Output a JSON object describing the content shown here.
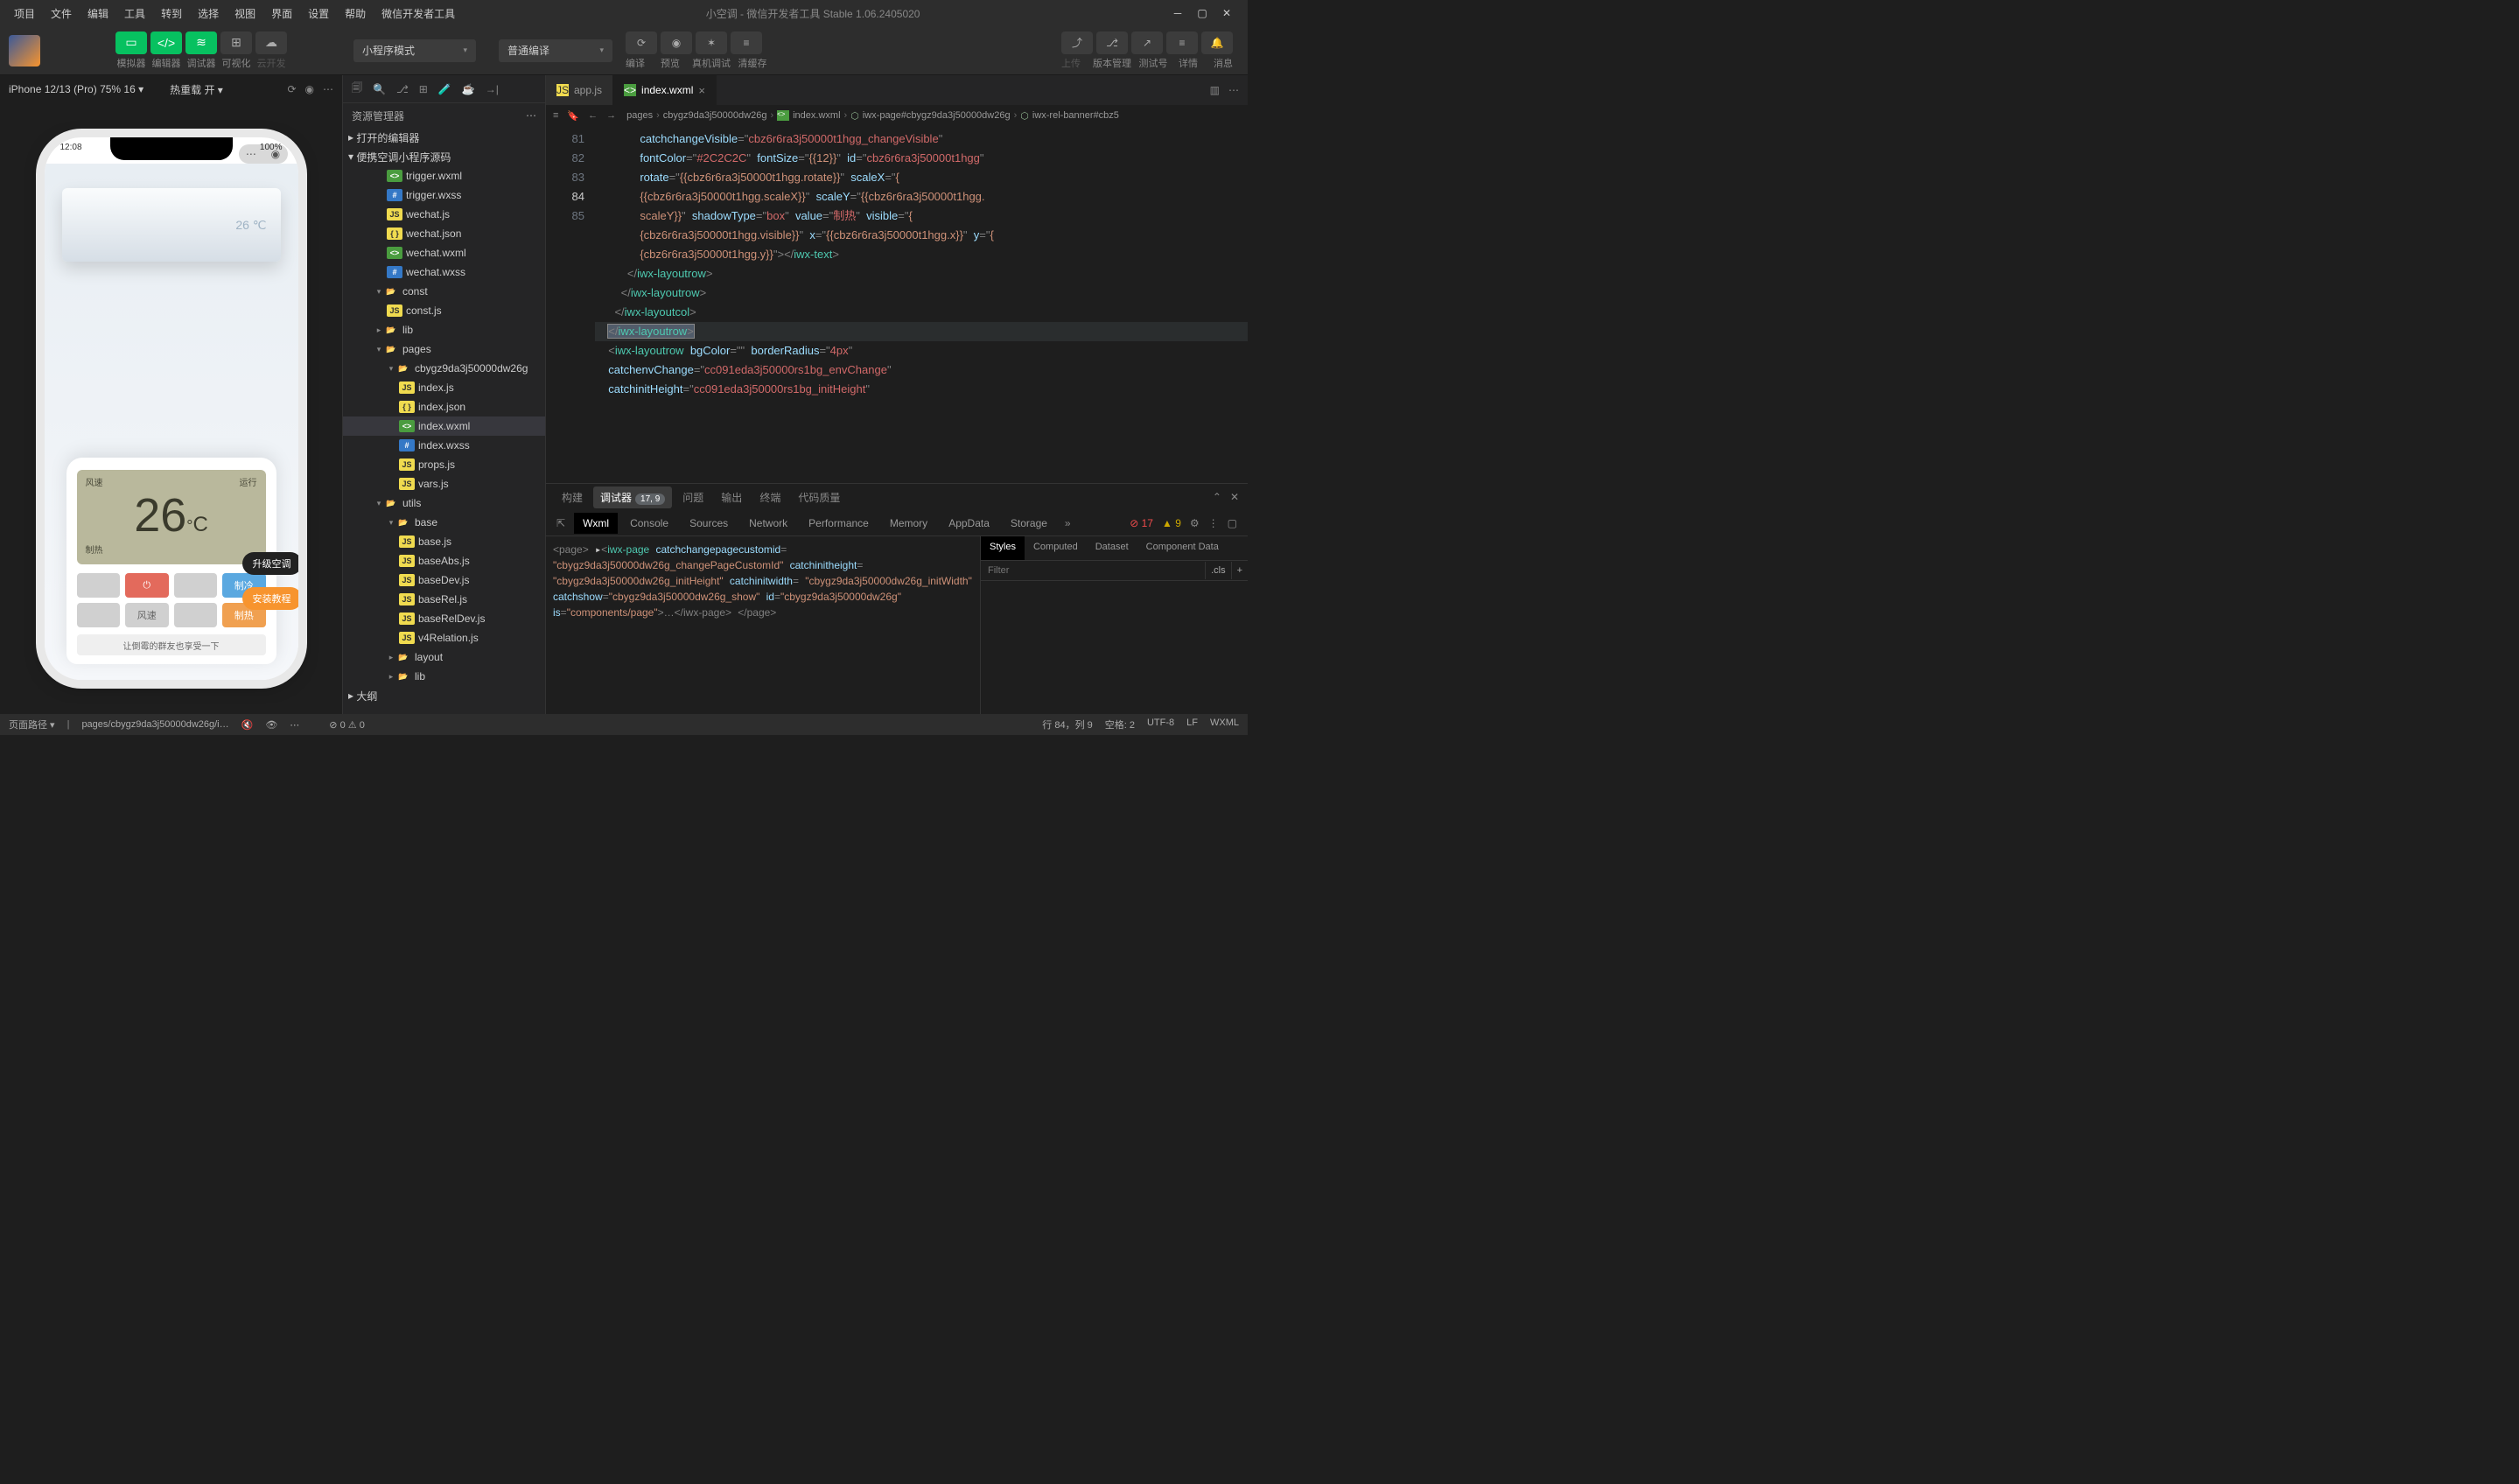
{
  "menubar": [
    "项目",
    "文件",
    "编辑",
    "工具",
    "转到",
    "选择",
    "视图",
    "界面",
    "设置",
    "帮助",
    "微信开发者工具"
  ],
  "title": "小空调 - 微信开发者工具 Stable 1.06.2405020",
  "toolbar": {
    "labels": [
      "模拟器",
      "编辑器",
      "调试器",
      "可视化",
      "云开发"
    ],
    "mode_dropdown": "小程序模式",
    "compile_dropdown": "普通编译",
    "compile": "编译",
    "preview": "预览",
    "real_debug": "真机调试",
    "clear_cache": "清缓存",
    "upload": "上传",
    "version_mgmt": "版本管理",
    "test_id": "测试号",
    "detail": "详情",
    "message": "消息"
  },
  "sim": {
    "device": "iPhone 12/13 (Pro) 75% 16",
    "hot_reload": "热重载 开",
    "time": "12:08",
    "battery": "100%",
    "ac_temp": "26 ℃",
    "lcd_top_left": "风速",
    "lcd_top_right": "运行",
    "lcd_temp": "26",
    "lcd_mode": "制热",
    "btn_cool": "制冷",
    "btn_wind": "风速",
    "btn_heat": "制热",
    "share": "让倒霉的群友也享受一下",
    "pill_upgrade": "升级空调",
    "pill_install": "安装教程"
  },
  "explorer": {
    "title": "资源管理器",
    "sections": {
      "open_editors": "打开的编辑器",
      "project": "便携空调小程序源码",
      "outline": "大纲"
    },
    "files": [
      {
        "name": "trigger.wxml",
        "type": "wxml",
        "indent": 3
      },
      {
        "name": "trigger.wxss",
        "type": "wxss",
        "indent": 3
      },
      {
        "name": "wechat.js",
        "type": "js",
        "indent": 3
      },
      {
        "name": "wechat.json",
        "type": "json",
        "indent": 3
      },
      {
        "name": "wechat.wxml",
        "type": "wxml",
        "indent": 3
      },
      {
        "name": "wechat.wxss",
        "type": "wxss",
        "indent": 3
      },
      {
        "name": "const",
        "type": "folder",
        "indent": 2,
        "exp": true
      },
      {
        "name": "const.js",
        "type": "js",
        "indent": 3
      },
      {
        "name": "lib",
        "type": "folder-g",
        "indent": 2,
        "exp": false
      },
      {
        "name": "pages",
        "type": "folder",
        "indent": 2,
        "exp": true
      },
      {
        "name": "cbygz9da3j50000dw26g",
        "type": "folder",
        "indent": 3,
        "exp": true
      },
      {
        "name": "index.js",
        "type": "js",
        "indent": 4
      },
      {
        "name": "index.json",
        "type": "json",
        "indent": 4
      },
      {
        "name": "index.wxml",
        "type": "wxml",
        "indent": 4,
        "active": true
      },
      {
        "name": "index.wxss",
        "type": "wxss",
        "indent": 4
      },
      {
        "name": "props.js",
        "type": "js",
        "indent": 4
      },
      {
        "name": "vars.js",
        "type": "js",
        "indent": 4
      },
      {
        "name": "utils",
        "type": "folder-g",
        "indent": 2,
        "exp": true
      },
      {
        "name": "base",
        "type": "folder",
        "indent": 3,
        "exp": true
      },
      {
        "name": "base.js",
        "type": "js",
        "indent": 4
      },
      {
        "name": "baseAbs.js",
        "type": "js",
        "indent": 4
      },
      {
        "name": "baseDev.js",
        "type": "js",
        "indent": 4
      },
      {
        "name": "baseRel.js",
        "type": "js",
        "indent": 4
      },
      {
        "name": "baseRelDev.js",
        "type": "js",
        "indent": 4
      },
      {
        "name": "v4Relation.js",
        "type": "js",
        "indent": 4
      },
      {
        "name": "layout",
        "type": "folder",
        "indent": 3,
        "exp": false
      },
      {
        "name": "lib",
        "type": "folder-g",
        "indent": 3,
        "exp": false
      }
    ]
  },
  "tabs": [
    {
      "name": "app.js",
      "icon": "js",
      "active": false
    },
    {
      "name": "index.wxml",
      "icon": "wxml",
      "active": true
    }
  ],
  "breadcrumb": [
    "pages",
    "cbygz9da3j50000dw26g",
    "index.wxml",
    "iwx-page#cbygz9da3j50000dw26g",
    "iwx-rel-banner#cbz5"
  ],
  "code": {
    "line_numbers": [
      "",
      "",
      "",
      "",
      "",
      "",
      "",
      "81",
      "82",
      "83",
      "84",
      "85",
      "",
      "",
      ""
    ],
    "current_line": 10,
    "frag": {
      "attr_catchchange": "catchchangeVisible",
      "val_catchchange": "cbz6r6ra3j50000t1hgg_changeVisible",
      "attr_fontcolor": "fontColor",
      "val_fontcolor": "#2C2C2C",
      "attr_fontsize": "fontSize",
      "val_fontsize": "{{12}}",
      "attr_id": "id",
      "val_id": "cbz6r6ra3j50000t1hgg",
      "attr_rotate": "rotate",
      "val_rotate_a": "{{cbz6r6ra3j50000t1hgg.rotate}}",
      "attr_scalex": "scaleX",
      "val_scalex": "{{cbz6r6ra3j50000t1hgg.scaleX}}",
      "attr_scaley": "scaleY",
      "val_scaley_a": "{{cbz6r6ra3j50000t1hgg.",
      "val_scaley_b": "scaleY}}",
      "attr_shadow": "shadowType",
      "val_shadow": "box",
      "attr_value": "value",
      "val_value": "制热",
      "attr_visible": "visible",
      "val_visible_a": "{",
      "val_visible_b": "{cbz6r6ra3j50000t1hgg.visible}}",
      "attr_x": "x",
      "val_x": "{{cbz6r6ra3j50000t1hgg.x}}",
      "attr_y": "y",
      "val_y_a": "{",
      "val_y_b": "{cbz6r6ra3j50000t1hgg.y}}",
      "close_text": "iwx-text",
      "close_layoutrow": "iwx-layoutrow",
      "close_layoutcol": "iwx-layoutcol",
      "open_layoutrow": "iwx-layoutrow",
      "attr_bgcolor": "bgColor",
      "attr_border": "borderRadius",
      "val_border": "4px",
      "attr_catchenv": "catchenvChange",
      "val_catchenv": "cc091eda3j50000rs1bg_envChange",
      "attr_catchinit": "catchinitHeight",
      "val_catchinit": "cc091eda3j50000rs1bg_initHeight"
    }
  },
  "bpanel": {
    "tabs": [
      "构建",
      "调试器",
      "问题",
      "输出",
      "终端",
      "代码质量"
    ],
    "badge": "17, 9",
    "active_idx": 1
  },
  "devtools": {
    "tabs": [
      "Wxml",
      "Console",
      "Sources",
      "Network",
      "Performance",
      "Memory",
      "AppData",
      "Storage"
    ],
    "errors": "17",
    "warnings": "9",
    "dom_page_open": "<page>",
    "dom_iwxpage": "iwx-page",
    "dom_attr1": "catchchangepagecustomid",
    "dom_val1": "cbygz9da3j50000dw26g_changePageCustomId",
    "dom_attr2": "catchinitheight",
    "dom_val2": "cbygz9da3j50000dw26g_initHeight",
    "dom_attr3": "catchinitwidth",
    "dom_val3": "cbygz9da3j50000dw26g_initWidth",
    "dom_attr4": "catchshow",
    "dom_val4": "cbygz9da3j50000dw26g_show",
    "dom_attr5": "id",
    "dom_val5": "cbygz9da3j50000dw26g",
    "dom_attr6": "is",
    "dom_val6": "components/page",
    "dom_close_iwx": "</iwx-page>",
    "dom_page_close": "</page>",
    "styles_tabs": [
      "Styles",
      "Computed",
      "Dataset",
      "Component Data"
    ],
    "filter_ph": "Filter",
    "cls": ".cls"
  },
  "status": {
    "page_path_label": "页面路径",
    "page_path": "pages/cbygz9da3j50000dw26g/i…",
    "err": "0",
    "warn": "0",
    "line_col": "行 84，列 9",
    "spaces": "空格: 2",
    "encoding": "UTF-8",
    "eol": "LF",
    "lang": "WXML"
  }
}
